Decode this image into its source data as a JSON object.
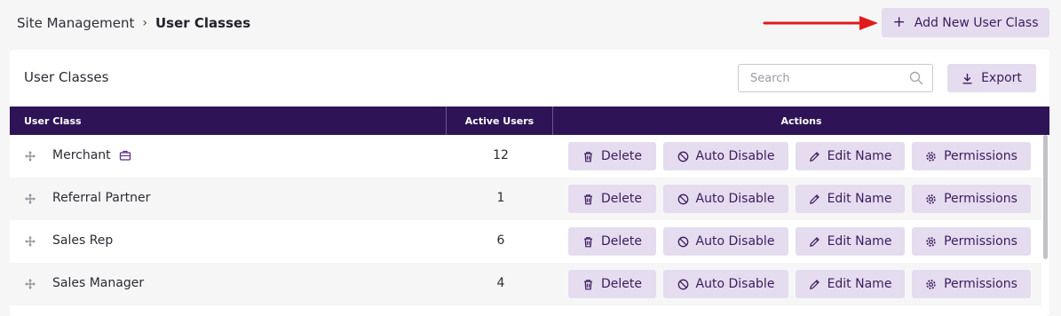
{
  "breadcrumb": {
    "parent": "Site Management",
    "separator": "›",
    "current": "User Classes"
  },
  "header": {
    "add_button_label": "Add New User Class",
    "arrow_color": "#e11b1b"
  },
  "card": {
    "title": "User Classes",
    "search_placeholder": "Search",
    "export_label": "Export"
  },
  "table": {
    "columns": [
      "User Class",
      "Active Users",
      "Actions"
    ],
    "rows": [
      {
        "name": "Merchant",
        "active_users": "12",
        "has_badge": true
      },
      {
        "name": "Referral Partner",
        "active_users": "1",
        "has_badge": false
      },
      {
        "name": "Sales Rep",
        "active_users": "6",
        "has_badge": false
      },
      {
        "name": "Sales Manager",
        "active_users": "4",
        "has_badge": false
      }
    ],
    "actions": {
      "delete": "Delete",
      "auto_disable": "Auto Disable",
      "edit_name": "Edit Name",
      "permissions": "Permissions"
    }
  },
  "colors": {
    "header_bg": "#2e1456",
    "button_bg": "#e5dcef",
    "button_text": "#3a1c5e",
    "page_bg": "#f6f6f7"
  }
}
